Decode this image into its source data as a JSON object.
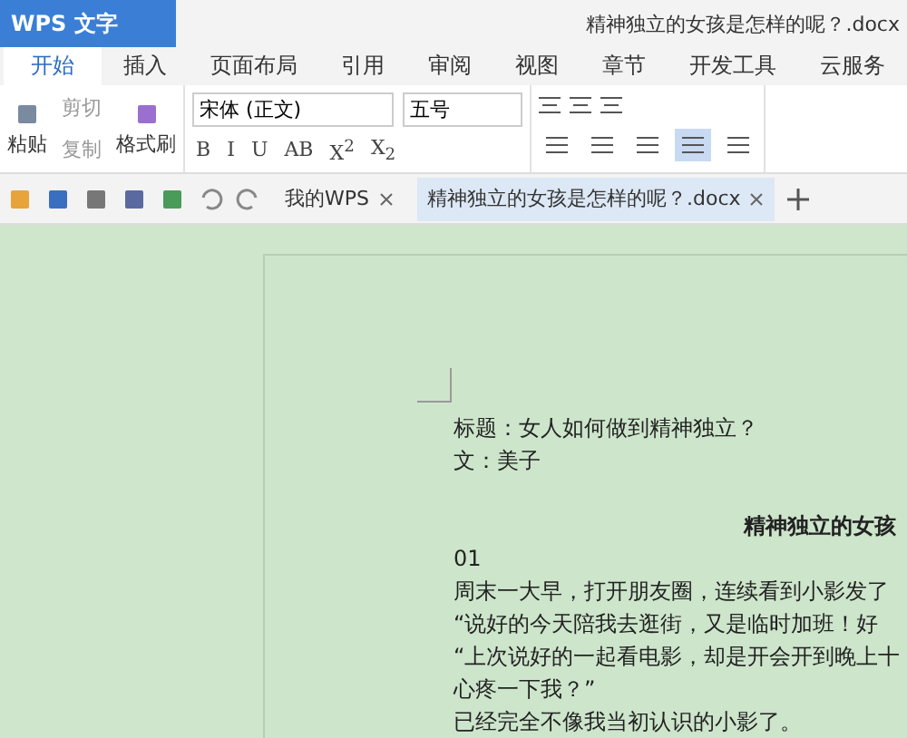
{
  "title_bar": {
    "app_name": "WPS 文字",
    "document_title": "精神独立的女孩是怎样的呢？.docx"
  },
  "menu_tabs": [
    {
      "label": "开始",
      "selected": true
    },
    {
      "label": "插入",
      "selected": false
    },
    {
      "label": "页面布局",
      "selected": false
    },
    {
      "label": "引用",
      "selected": false
    },
    {
      "label": "审阅",
      "selected": false
    },
    {
      "label": "视图",
      "selected": false
    },
    {
      "label": "章节",
      "selected": false
    },
    {
      "label": "开发工具",
      "selected": false
    },
    {
      "label": "云服务",
      "selected": false
    }
  ],
  "clipboard": {
    "paste": "粘贴",
    "cut": "剪切",
    "copy": "复制",
    "format_painter": "格式刷"
  },
  "font": {
    "family": "宋体 (正文)",
    "size": "五号",
    "styles": [
      "B",
      "I",
      "U",
      "AB",
      "X$^{2}$",
      "X$_{2}$"
    ]
  },
  "alignment": [
    {
      "selected": false
    },
    {
      "selected": false
    },
    {
      "selected": false
    },
    {
      "selected": true
    },
    {
      "selected": false
    }
  ],
  "doc_tabs": [
    {
      "label": "我的WPS",
      "selected": false
    },
    {
      "label": "精神独立的女孩是怎样的呢？.docx",
      "selected": true
    }
  ],
  "document": {
    "lines": [
      {
        "kind": "plain",
        "text": "标题：女人如何做到精神独立？"
      },
      {
        "kind": "plain",
        "text": "文：美子"
      },
      {
        "kind": "heading",
        "text": "精神独立的女孩"
      },
      {
        "kind": "plain",
        "text": "01"
      },
      {
        "kind": "plain",
        "text": "周末一大早，打开朋友圈，连续看到小影发了"
      },
      {
        "kind": "plain",
        "text": "“说好的今天陪我去逛街，又是临时加班！好"
      },
      {
        "kind": "plain",
        "text": "“上次说好的一起看电影，却是开会开到晚上十"
      },
      {
        "kind": "plain",
        "text": "心疼一下我？”"
      },
      {
        "kind": "plain",
        "text": "已经完全不像我当初认识的小影了。"
      }
    ]
  }
}
